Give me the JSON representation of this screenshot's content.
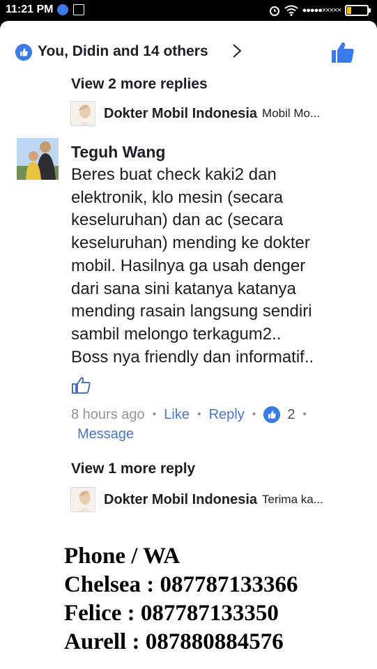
{
  "status_bar": {
    "time": "11:21 PM",
    "signal": "●●●●●×××××"
  },
  "reactions": {
    "summary": "You, Didin and 14 others",
    "accent": "#3b7be8"
  },
  "thread": {
    "view_more_top": "View 2 more replies",
    "reply_top": {
      "name": "Dokter Mobil Indonesia",
      "snippet": "Mobil Mo..."
    },
    "comment": {
      "author": "Teguh Wang",
      "lines": [
        "Beres buat check kaki2 dan",
        "elektronik, klo mesin (secara",
        "keseluruhan) dan ac (secara",
        "keseluruhan) mending ke dokter",
        "mobil. Hasilnya ga usah denger",
        "dari sana sini katanya katanya",
        "mending rasain langsung sendiri",
        "sambil melongo terkagum2..",
        "Boss nya friendly dan informatif.."
      ],
      "time": "8 hours ago",
      "like": "Like",
      "reply": "Reply",
      "like_count": "2",
      "message": "Message"
    },
    "view_more_bottom": "View 1 more reply",
    "reply_bottom": {
      "name": "Dokter Mobil Indonesia",
      "snippet": "Terima ka..."
    }
  },
  "contact": {
    "heading": "Phone / WA",
    "lines": [
      "Chelsea : 087787133366",
      "Felice : 087787133350",
      "Aurell : 087880884576"
    ]
  }
}
